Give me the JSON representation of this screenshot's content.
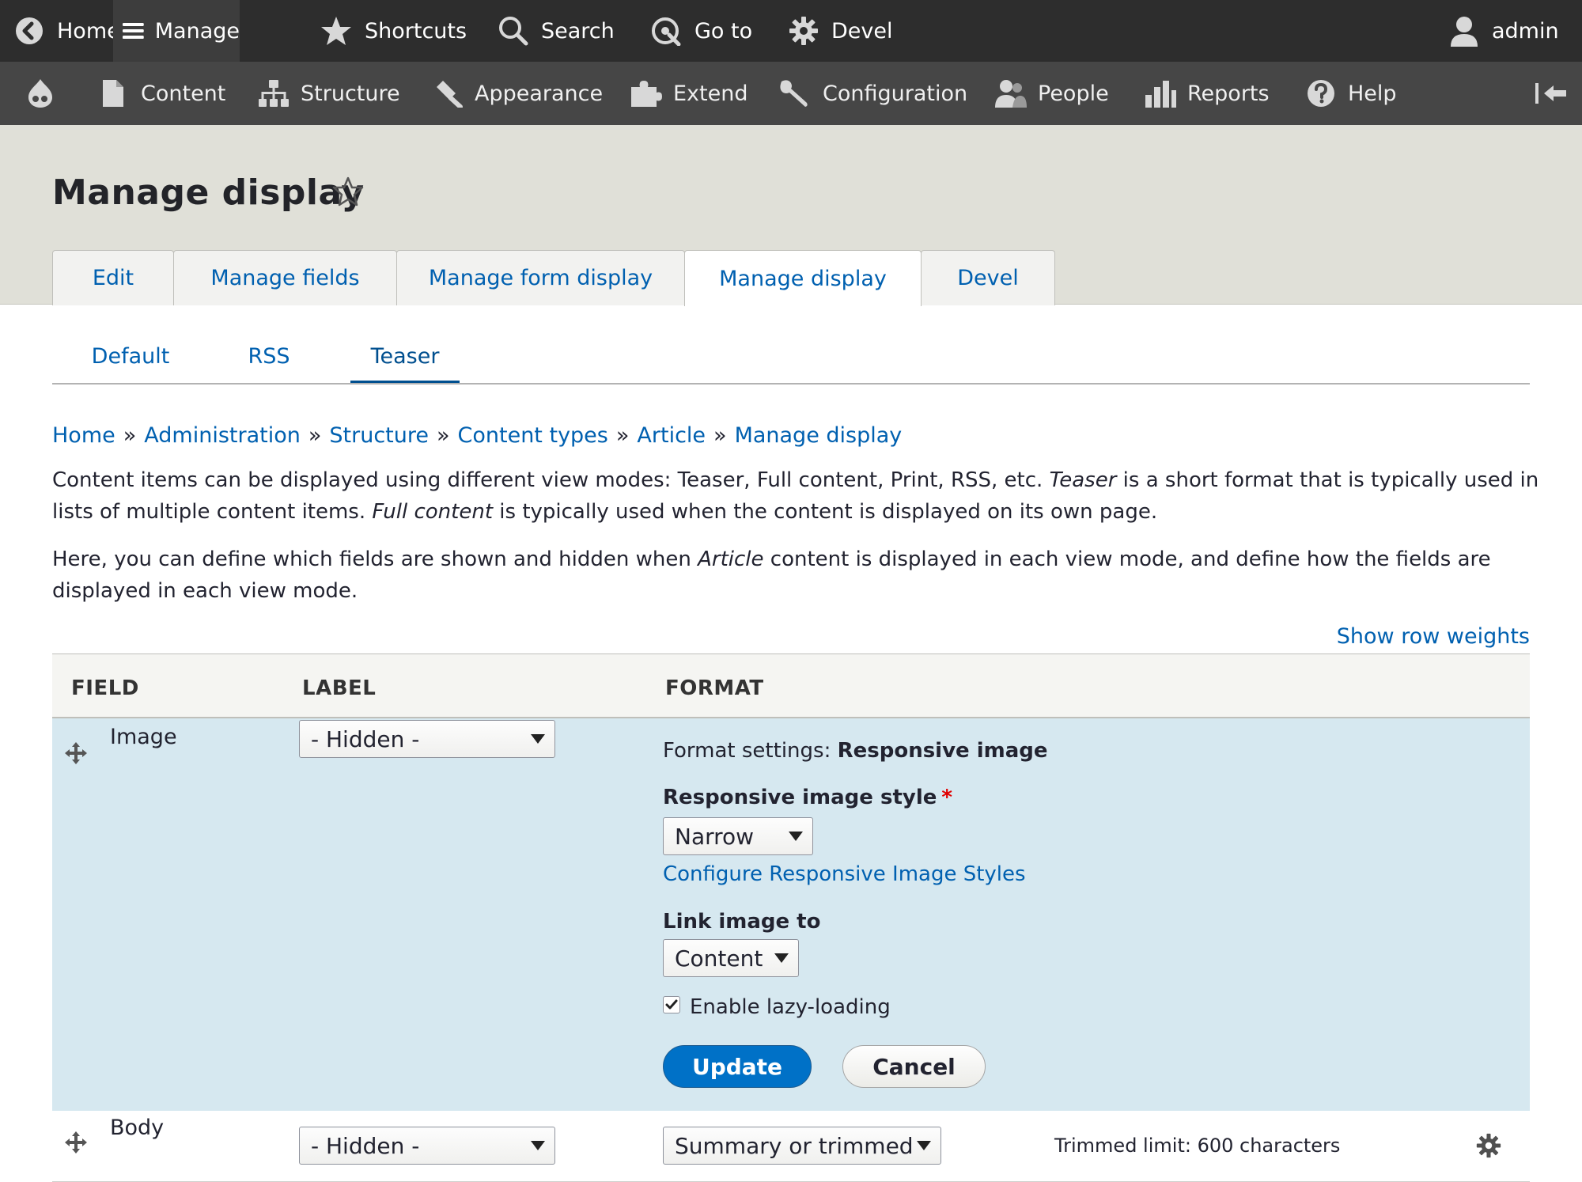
{
  "toolbar": {
    "home": "Home",
    "manage": "Manage",
    "shortcuts": "Shortcuts",
    "search": "Search",
    "goto": "Go to",
    "devel": "Devel",
    "user": "admin"
  },
  "admin_menu": {
    "content": "Content",
    "structure": "Structure",
    "appearance": "Appearance",
    "extend": "Extend",
    "configuration": "Configuration",
    "people": "People",
    "reports": "Reports",
    "help": "Help"
  },
  "page": {
    "title": "Manage display"
  },
  "primary_tabs": [
    "Edit",
    "Manage fields",
    "Manage form display",
    "Manage display",
    "Devel"
  ],
  "secondary_tabs": [
    "Default",
    "RSS",
    "Teaser"
  ],
  "breadcrumb": [
    "Home",
    "Administration",
    "Structure",
    "Content types",
    "Article",
    "Manage display"
  ],
  "breadcrumb_sep": "»",
  "description": {
    "p1_a": "Content items can be displayed using different view modes: Teaser, Full content, Print, RSS, etc. ",
    "p1_em1": "Teaser",
    "p1_b": " is a short format that is typically used in lists of multiple content items. ",
    "p1_em2": "Full content",
    "p1_c": " is typically used when the content is displayed on its own page.",
    "p2_a": "Here, you can define which fields are shown and hidden when ",
    "p2_em": "Article",
    "p2_b": " content is displayed in each view mode, and define how the fields are displayed in each view mode."
  },
  "show_row_weights": "Show row weights",
  "table": {
    "headers": [
      "FIELD",
      "LABEL",
      "FORMAT"
    ],
    "rows": [
      {
        "field": "Image",
        "label_select": "- Hidden -",
        "format_settings_prefix": "Format settings: ",
        "format_settings_name": "Responsive image",
        "style_label": "Responsive image style",
        "required_mark": "*",
        "style_value": "Narrow",
        "configure_link": "Configure Responsive Image Styles",
        "link_label": "Link image to",
        "link_value": "Content",
        "lazy_label": "Enable lazy-loading",
        "lazy_checked": true,
        "update_button": "Update",
        "cancel_button": "Cancel"
      },
      {
        "field": "Body",
        "label_select": "- Hidden -",
        "format_select": "Summary or trimmed",
        "summary": "Trimmed limit: 600 characters"
      }
    ]
  },
  "colors": {
    "toolbar_dark": "#2d2d2d",
    "toolbar_secondary": "#464646",
    "link": "#0060b0",
    "row_highlight": "#d6e8f0",
    "primary_button": "#0071c7"
  }
}
